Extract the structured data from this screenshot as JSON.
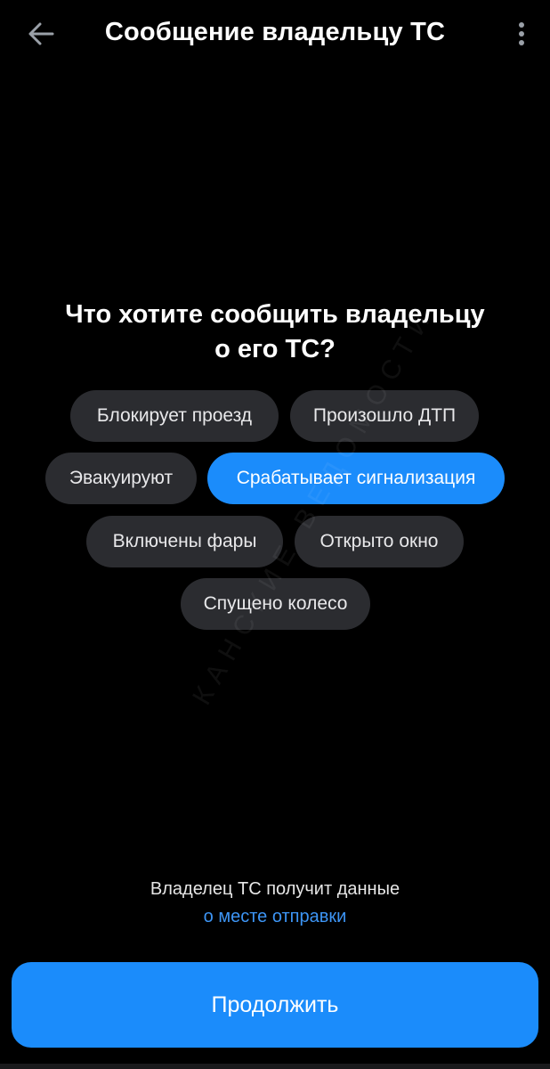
{
  "header": {
    "title": "Сообщение владельцу ТС",
    "back_icon": "arrow-left-icon",
    "menu_icon": "more-vertical-icon"
  },
  "question": {
    "line1": "Что хотите сообщить владельцу",
    "line2": "о его ТС?"
  },
  "chips": [
    {
      "label": "Блокирует проезд",
      "selected": false
    },
    {
      "label": "Произошло ДТП",
      "selected": false
    },
    {
      "label": "Эвакуируют",
      "selected": false
    },
    {
      "label": "Срабатывает сигнализация",
      "selected": true
    },
    {
      "label": "Включены фары",
      "selected": false
    },
    {
      "label": "Открыто окно",
      "selected": false
    },
    {
      "label": "Спущено колесо",
      "selected": false
    }
  ],
  "info": {
    "text": "Владелец ТС получит данные",
    "link": "о месте отправки"
  },
  "continue_label": "Продолжить",
  "watermark": "КАНСКИЕ ВЕДОМОСТИ",
  "colors": {
    "background": "#000000",
    "chip": "#2b2c30",
    "accent": "#1b8cfb",
    "link": "#3d95f5"
  }
}
